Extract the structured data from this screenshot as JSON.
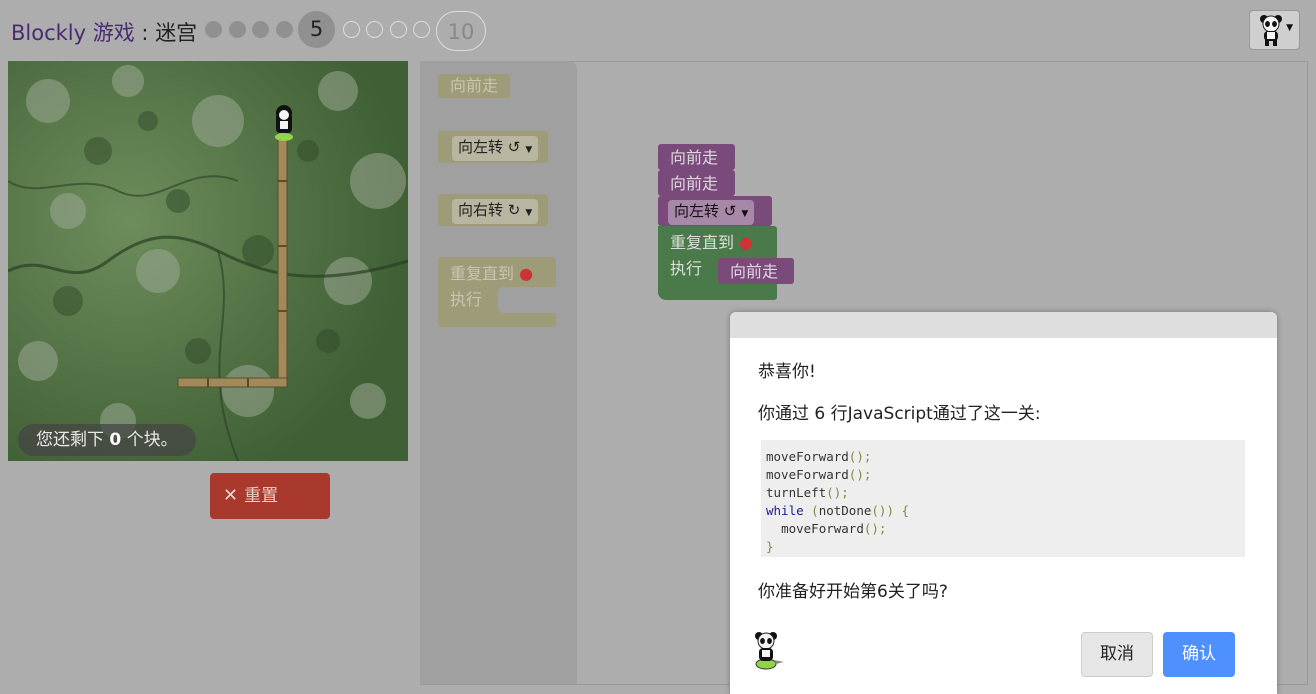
{
  "header": {
    "app_name": "Blockly",
    "game_name": "游戏",
    "separator": " : ",
    "puzzle_name": "迷宫",
    "current_level": "5",
    "last_level": "10"
  },
  "map": {
    "blocks_remaining_prefix": "您还剩下 ",
    "blocks_remaining_count": "0",
    "blocks_remaining_suffix": " 个块。"
  },
  "controls": {
    "reset_label": "重置"
  },
  "toolbox": {
    "move_forward": "向前走",
    "turn_left": "向左转",
    "turn_left_arrow": "↺",
    "turn_right": "向右转",
    "turn_right_arrow": "↻",
    "repeat_until": "重复直到",
    "do_label": "执行"
  },
  "program": {
    "line1": "向前走",
    "line2": "向前走",
    "line3_label": "向左转",
    "line3_arrow": "↺",
    "repeat_label": "重复直到",
    "do_label": "执行",
    "inner": "向前走"
  },
  "dialog": {
    "congrats": "恭喜你!",
    "lines_msg": "你通过 6 行JavaScript通过了这一关:",
    "code": {
      "l1_fn": "moveForward",
      "l2_fn": "moveForward",
      "l3_fn": "turnLeft",
      "l4_kw": "while",
      "l4_cond": "notDone",
      "l5_fn": "moveForward",
      "paren_call": "();",
      "brace_close": "}"
    },
    "next_prompt": "你准备好开始第6关了吗?",
    "cancel_label": "取消",
    "ok_label": "确认"
  },
  "colors": {
    "purple_block": "#7a4b7a",
    "green_block": "#4a7a4a",
    "reset_red": "#a8392c",
    "ok_blue": "#4d90fe"
  }
}
